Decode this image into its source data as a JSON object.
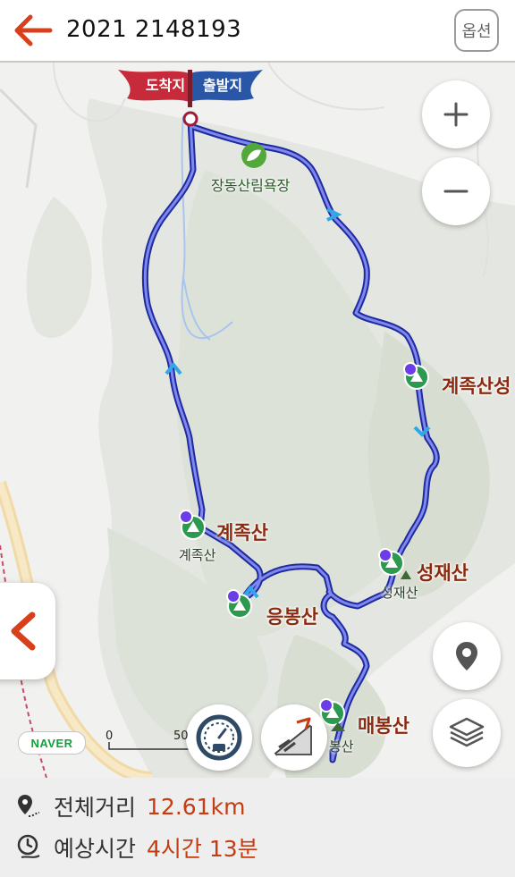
{
  "header": {
    "title": "2021 2148193",
    "option_label": "옵션"
  },
  "map": {
    "flags": {
      "arrival": "도착지",
      "departure": "출발지"
    },
    "places": {
      "rest_area": "장동산림욕장",
      "gyejoksan_label": "계족산",
      "gyejoksan_small": "계족산",
      "gyejoksanseong": "계족산성",
      "seongjaesan": "성재산",
      "seongjaesan_small": "성재산",
      "eungbongsan": "응봉산",
      "maebongsan": "매봉산",
      "maebongsan_small": "봉산"
    },
    "controls": {
      "zoom_in": "+",
      "zoom_out": "−"
    },
    "attribution": "NAVER",
    "scale": {
      "start": "0",
      "end": "50"
    }
  },
  "summary": {
    "distance_label": "전체거리",
    "distance_value": "12.61km",
    "time_label": "예상시간",
    "time_value": "4시간 13분"
  },
  "colors": {
    "accent": "#d8401c",
    "route": "#3a42c8",
    "value": "#c43c12"
  }
}
